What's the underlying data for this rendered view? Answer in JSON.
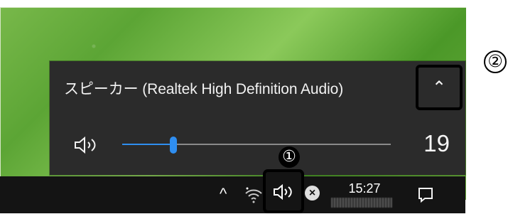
{
  "popup": {
    "device_title": "スピーカー (Realtek High Definition Audio)",
    "expand_icon": "chevron-up-icon",
    "speaker_icon": "speaker-icon",
    "volume_level": 19,
    "volume_value": "19"
  },
  "taskbar": {
    "tray_chevron": "^",
    "time": "15:27",
    "network_icon": "wifi-icon",
    "volume_icon": "speaker-icon",
    "close_badge": "×",
    "notification_icon": "notification-icon"
  },
  "callouts": {
    "one": "①",
    "two": "②"
  },
  "colors": {
    "popup_bg": "#2b2b2b",
    "taskbar_bg": "#141414",
    "accent": "#2f8ef0",
    "desktop": "#6caf3e"
  }
}
